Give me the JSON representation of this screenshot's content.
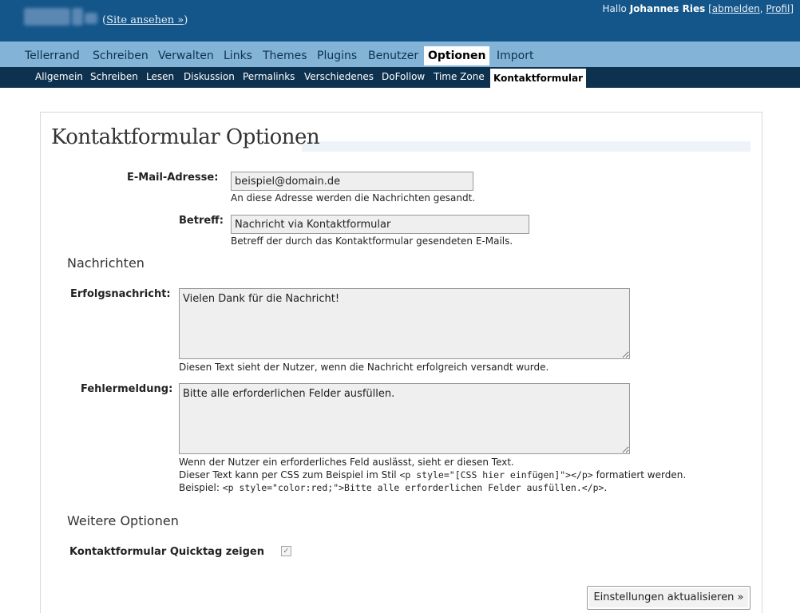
{
  "header": {
    "site_link_label": "Site ansehen »",
    "greeting": "Hallo",
    "user_name": "Johannes Ries",
    "logout_label": "abmelden",
    "profile_label": "Profil",
    "bg_color": "#14568a"
  },
  "menu": {
    "items": [
      "Tellerrand",
      "Schreiben",
      "Verwalten",
      "Links",
      "Themes",
      "Plugins",
      "Benutzer",
      "Optionen",
      "Import"
    ],
    "active": "Optionen"
  },
  "submenu": {
    "items": [
      "Allgemein",
      "Schreiben",
      "Lesen",
      "Diskussion",
      "Permalinks",
      "Verschiedenes",
      "DoFollow",
      "Time Zone",
      "Kontaktformular"
    ],
    "active": "Kontaktformular"
  },
  "page": {
    "title": "Kontaktformular Optionen"
  },
  "form": {
    "email": {
      "label": "E-Mail-Adresse",
      "value": "beispiel@domain.de",
      "hint": "An diese Adresse werden die Nachrichten gesandt."
    },
    "subject": {
      "label": "Betreff",
      "value": "Nachricht via Kontaktformular",
      "hint": "Betreff der durch das Kontaktformular gesendeten E-Mails."
    },
    "messages_heading": "Nachrichten",
    "success": {
      "label": "Erfolgsnachricht",
      "value": "Vielen Dank für die Nachricht!",
      "hint": "Diesen Text sieht der Nutzer, wenn die Nachricht erfolgreich versandt wurde."
    },
    "error": {
      "label": "Fehlermeldung",
      "value": "Bitte alle erforderlichen Felder ausfüllen.",
      "hint_line1": "Wenn der Nutzer ein erforderliches Feld auslässt, sieht er diesen Text.",
      "hint_line2_pre": "Dieser Text kann per CSS zum Beispiel im Stil ",
      "hint_line2_code": "<p style=\"[CSS hier einfügen]\"></p>",
      "hint_line2_post": " formatiert werden.",
      "hint_line3_pre": "Beispiel: ",
      "hint_line3_code": "<p style=\"color:red;\">Bitte alle erforderlichen Felder ausfüllen.</p>",
      "hint_line3_post": "."
    },
    "more_heading": "Weitere Optionen",
    "quicktag": {
      "label": "Kontaktformular Quicktag zeigen",
      "checked": true
    },
    "submit_label": "Einstellungen aktualisieren »"
  }
}
